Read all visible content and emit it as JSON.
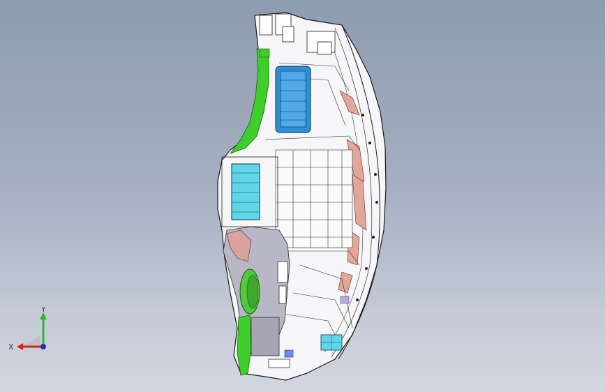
{
  "viewport": {
    "background_top": "#8e9bb0",
    "background_bottom": "#d2d6df"
  },
  "model": {
    "colors": {
      "shell": "#ffffff",
      "edge": "#1a1a1a",
      "green_trim": "#3fcf2a",
      "blue_vent": "#2b8fd8",
      "cyan_vent": "#5fd7e8",
      "gray_panel": "#b7b7c6",
      "pink_rib": "#e3a79a",
      "light_blue_part": "#6a8cf0"
    }
  },
  "triad": {
    "x_label": "X",
    "y_label": "Y",
    "x_color": "#d61f1f",
    "y_color": "#2fb52f",
    "origin_color": "#1e2fd6"
  }
}
